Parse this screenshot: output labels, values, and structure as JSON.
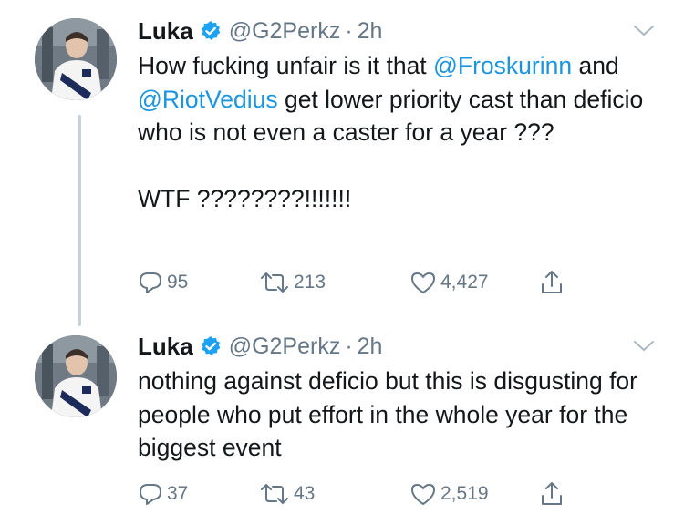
{
  "tweets": [
    {
      "author": {
        "name": "Luka",
        "handle": "@G2Perkz",
        "time": "2h",
        "separator": "·"
      },
      "body": {
        "line1_pre": "How fucking unfair is it that ",
        "mention1": "@Froskurinn",
        "line2_pre": "and ",
        "mention2": "@RiotVedius",
        "line2_post": " get lower priority cast than deficio who is not even a caster for a year ???",
        "para2": "WTF ????????!!!!!!!"
      },
      "stats": {
        "replies": "95",
        "retweets": "213",
        "likes": "4,427"
      }
    },
    {
      "author": {
        "name": "Luka",
        "handle": "@G2Perkz",
        "time": "2h",
        "separator": "·"
      },
      "body": {
        "text": "nothing against deficio but this is disgusting for people who put effort in the whole year for the biggest event"
      },
      "stats": {
        "replies": "37",
        "retweets": "43",
        "likes": "2,519"
      }
    }
  ],
  "icons": {
    "verified": "verified-badge-icon",
    "reply": "reply-icon",
    "retweet": "retweet-icon",
    "like": "heart-icon",
    "share": "share-icon",
    "more": "chevron-down-icon"
  },
  "colors": {
    "mention": "#1b95e0",
    "verified": "#1da1f2",
    "muted": "#657786",
    "text": "#14171a"
  }
}
